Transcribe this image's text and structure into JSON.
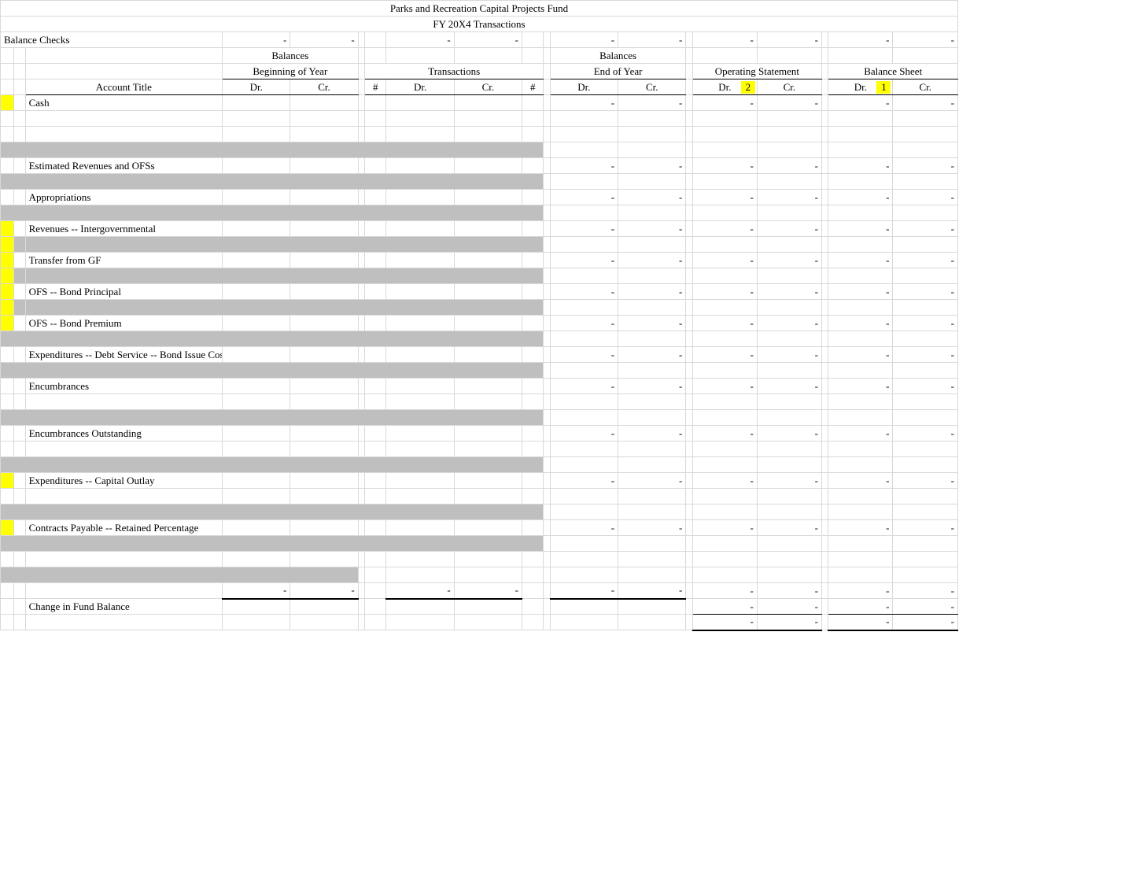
{
  "title1": "Parks and Recreation Capital Projects Fund",
  "title2": "FY 20X4 Transactions",
  "balance_checks": "Balance Checks",
  "headers": {
    "balances": "Balances",
    "begin": "Beginning of Year",
    "transactions": "Transactions",
    "end": "End of Year",
    "opstmt": "Operating Statement",
    "balsheet": "Balance Sheet",
    "account": "Account Title",
    "dr": "Dr.",
    "cr": "Cr.",
    "num": "#"
  },
  "chips": {
    "op": "2",
    "bs": "1"
  },
  "dash": "-",
  "rows": {
    "cash": "Cash",
    "estrev": "Estimated Revenues and OFSs",
    "approp": "Appropriations",
    "revig": "Revenues -- Intergovernmental",
    "tfromgf": "Transfer from GF",
    "ofsbp": "OFS -- Bond Principal",
    "ofsprem": "OFS -- Bond Premium",
    "expds": "Expenditures -- Debt Service -- Bond Issue Costs",
    "enc": "Encumbrances",
    "encout": "Encumbrances Outstanding",
    "expcap": "Expenditures -- Capital Outlay",
    "cpr": "Contracts Payable -- Retained Percentage",
    "chgfb": "Change in Fund Balance"
  }
}
